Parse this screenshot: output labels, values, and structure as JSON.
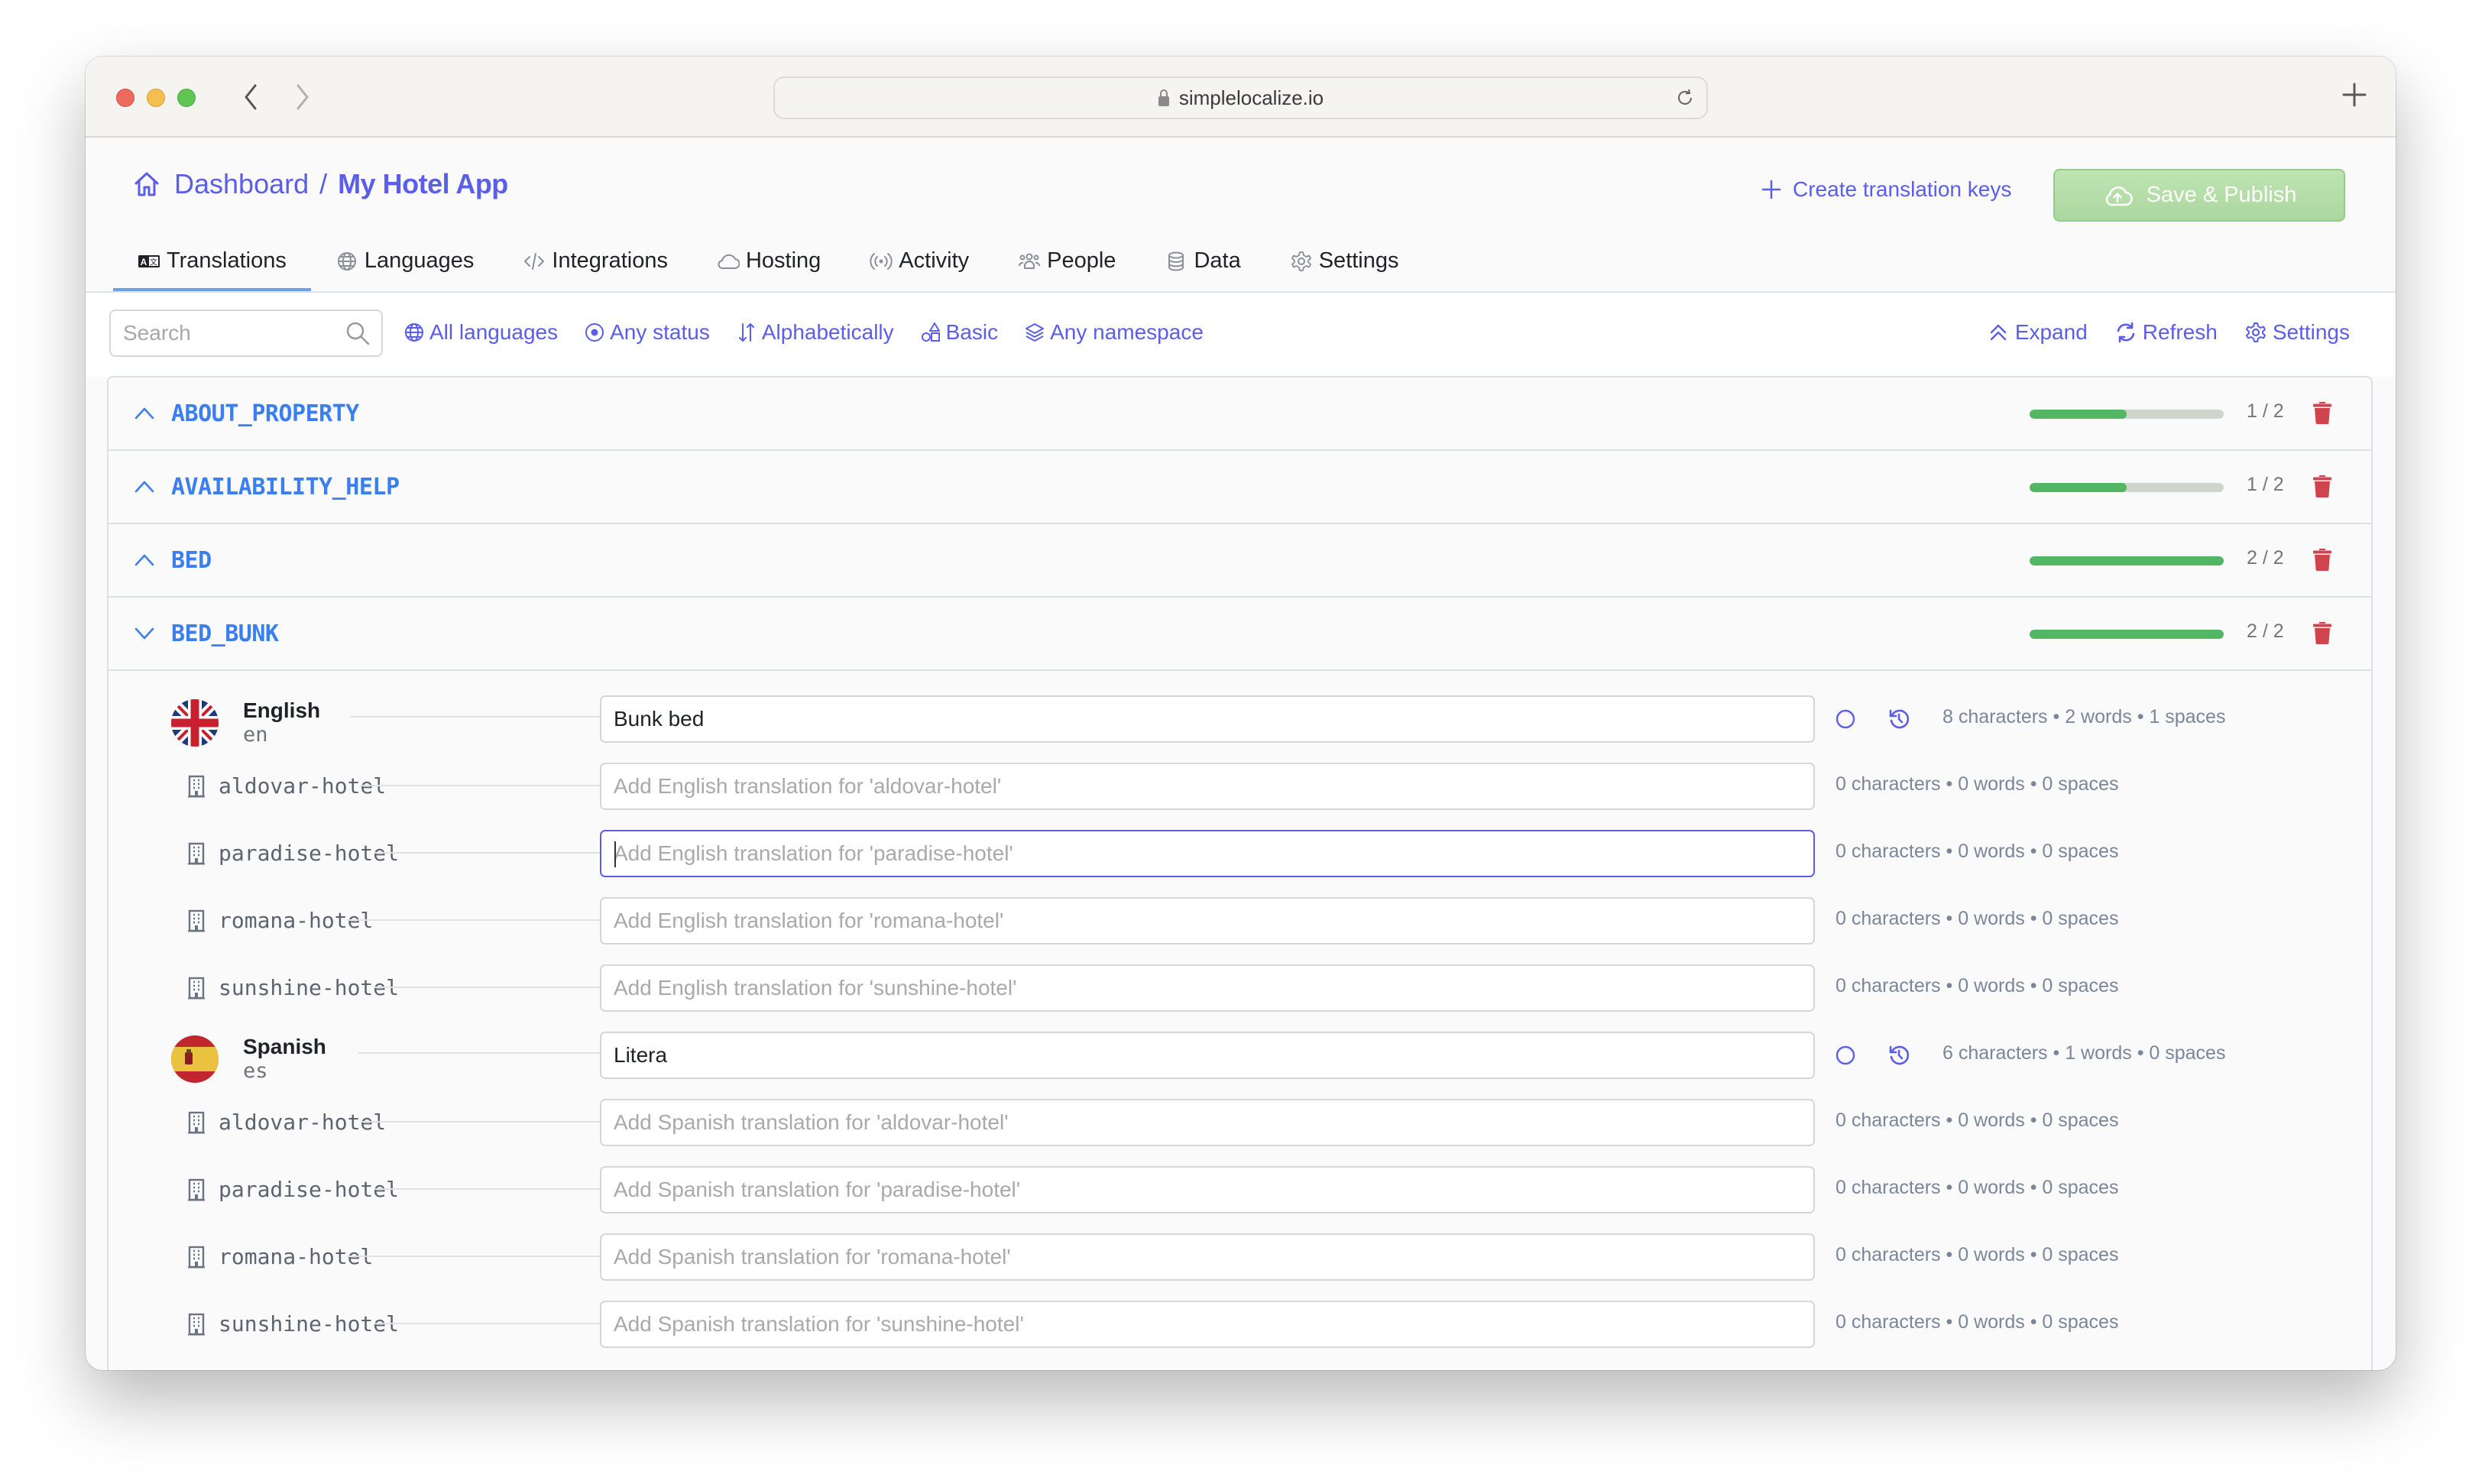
{
  "browser": {
    "url": "simplelocalize.io",
    "icons": [
      "back-arrow-icon",
      "forward-arrow-icon",
      "lock-icon",
      "reload-icon",
      "new-tab-icon"
    ]
  },
  "header": {
    "breadcrumb_root": "Dashboard",
    "breadcrumb_separator": "/",
    "breadcrumb_current": "My Hotel App",
    "create_keys_label": "Create translation keys",
    "save_publish_label": "Save & Publish"
  },
  "tabs": [
    {
      "label": "Translations",
      "icon": "translate-icon",
      "active": true
    },
    {
      "label": "Languages",
      "icon": "globe-icon"
    },
    {
      "label": "Integrations",
      "icon": "code-icon"
    },
    {
      "label": "Hosting",
      "icon": "cloud-icon"
    },
    {
      "label": "Activity",
      "icon": "broadcast-icon"
    },
    {
      "label": "People",
      "icon": "people-icon"
    },
    {
      "label": "Data",
      "icon": "database-icon"
    },
    {
      "label": "Settings",
      "icon": "gear-icon"
    }
  ],
  "toolbar": {
    "search_placeholder": "Search",
    "search_value": "",
    "filters": [
      {
        "label": "All languages",
        "icon": "globe-icon"
      },
      {
        "label": "Any status",
        "icon": "status-icon"
      },
      {
        "label": "Alphabetically",
        "icon": "sort-icon"
      },
      {
        "label": "Basic",
        "icon": "shapes-icon"
      },
      {
        "label": "Any namespace",
        "icon": "layers-icon"
      }
    ],
    "right_tools": [
      {
        "label": "Expand",
        "icon": "double-chevron-up-icon"
      },
      {
        "label": "Refresh",
        "icon": "refresh-icon"
      },
      {
        "label": "Settings",
        "icon": "gear-icon"
      }
    ]
  },
  "keys": [
    {
      "name": "ABOUT_PROPERTY",
      "expanded": false,
      "translated": 1,
      "total": 2,
      "count_label": "1 / 2"
    },
    {
      "name": "AVAILABILITY_HELP",
      "expanded": false,
      "translated": 1,
      "total": 2,
      "count_label": "1 / 2"
    },
    {
      "name": "BED",
      "expanded": false,
      "translated": 2,
      "total": 2,
      "count_label": "2 / 2"
    },
    {
      "name": "BED_BUNK",
      "expanded": true,
      "translated": 2,
      "total": 2,
      "count_label": "2 / 2"
    }
  ],
  "expanded_key": {
    "languages": [
      {
        "name": "English",
        "code": "en",
        "value": "Bunk bed",
        "stats": "8 characters • 2 words • 1 spaces",
        "customers": [
          {
            "name": "aldovar-hotel",
            "value": "",
            "placeholder": "Add English translation for 'aldovar-hotel'",
            "stats": "0 characters • 0 words • 0 spaces"
          },
          {
            "name": "paradise-hotel",
            "value": "",
            "placeholder": "Add English translation for 'paradise-hotel'",
            "stats": "0 characters • 0 words • 0 spaces",
            "focused": true
          },
          {
            "name": "romana-hotel",
            "value": "",
            "placeholder": "Add English translation for 'romana-hotel'",
            "stats": "0 characters • 0 words • 0 spaces"
          },
          {
            "name": "sunshine-hotel",
            "value": "",
            "placeholder": "Add English translation for 'sunshine-hotel'",
            "stats": "0 characters • 0 words • 0 spaces"
          }
        ]
      },
      {
        "name": "Spanish",
        "code": "es",
        "value": "Litera",
        "stats": "6 characters • 1 words • 0 spaces",
        "customers": [
          {
            "name": "aldovar-hotel",
            "value": "",
            "placeholder": "Add Spanish translation for 'aldovar-hotel'",
            "stats": "0 characters • 0 words • 0 spaces"
          },
          {
            "name": "paradise-hotel",
            "value": "",
            "placeholder": "Add Spanish translation for 'paradise-hotel'",
            "stats": "0 characters • 0 words • 0 spaces"
          },
          {
            "name": "romana-hotel",
            "value": "",
            "placeholder": "Add Spanish translation for 'romana-hotel'",
            "stats": "0 characters • 0 words • 0 spaces"
          },
          {
            "name": "sunshine-hotel",
            "value": "",
            "placeholder": "Add Spanish translation for 'sunshine-hotel'",
            "stats": "0 characters • 0 words • 0 spaces"
          }
        ]
      }
    ]
  },
  "colors": {
    "accent": "#5a5ee8",
    "key_name": "#3b7ef0",
    "progress_fill": "#52b765",
    "progress_track": "#cfd5cc",
    "delete": "#d0454c",
    "publish_button": "#b5dfa9",
    "active_tab_underline": "#6a9ff0"
  }
}
